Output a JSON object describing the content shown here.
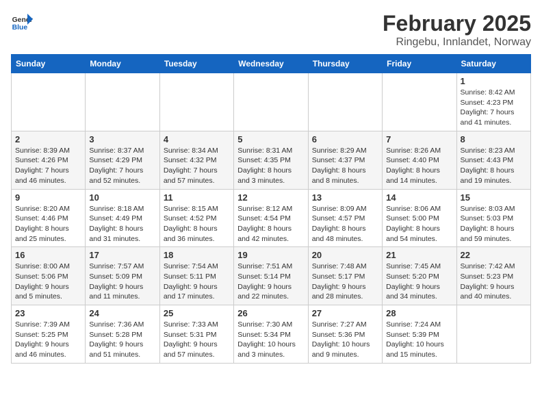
{
  "header": {
    "logo_general": "General",
    "logo_blue": "Blue",
    "month_title": "February 2025",
    "location": "Ringebu, Innlandet, Norway"
  },
  "weekdays": [
    "Sunday",
    "Monday",
    "Tuesday",
    "Wednesday",
    "Thursday",
    "Friday",
    "Saturday"
  ],
  "weeks": [
    [
      {
        "day": "",
        "info": ""
      },
      {
        "day": "",
        "info": ""
      },
      {
        "day": "",
        "info": ""
      },
      {
        "day": "",
        "info": ""
      },
      {
        "day": "",
        "info": ""
      },
      {
        "day": "",
        "info": ""
      },
      {
        "day": "1",
        "info": "Sunrise: 8:42 AM\nSunset: 4:23 PM\nDaylight: 7 hours\nand 41 minutes."
      }
    ],
    [
      {
        "day": "2",
        "info": "Sunrise: 8:39 AM\nSunset: 4:26 PM\nDaylight: 7 hours\nand 46 minutes."
      },
      {
        "day": "3",
        "info": "Sunrise: 8:37 AM\nSunset: 4:29 PM\nDaylight: 7 hours\nand 52 minutes."
      },
      {
        "day": "4",
        "info": "Sunrise: 8:34 AM\nSunset: 4:32 PM\nDaylight: 7 hours\nand 57 minutes."
      },
      {
        "day": "5",
        "info": "Sunrise: 8:31 AM\nSunset: 4:35 PM\nDaylight: 8 hours\nand 3 minutes."
      },
      {
        "day": "6",
        "info": "Sunrise: 8:29 AM\nSunset: 4:37 PM\nDaylight: 8 hours\nand 8 minutes."
      },
      {
        "day": "7",
        "info": "Sunrise: 8:26 AM\nSunset: 4:40 PM\nDaylight: 8 hours\nand 14 minutes."
      },
      {
        "day": "8",
        "info": "Sunrise: 8:23 AM\nSunset: 4:43 PM\nDaylight: 8 hours\nand 19 minutes."
      }
    ],
    [
      {
        "day": "9",
        "info": "Sunrise: 8:20 AM\nSunset: 4:46 PM\nDaylight: 8 hours\nand 25 minutes."
      },
      {
        "day": "10",
        "info": "Sunrise: 8:18 AM\nSunset: 4:49 PM\nDaylight: 8 hours\nand 31 minutes."
      },
      {
        "day": "11",
        "info": "Sunrise: 8:15 AM\nSunset: 4:52 PM\nDaylight: 8 hours\nand 36 minutes."
      },
      {
        "day": "12",
        "info": "Sunrise: 8:12 AM\nSunset: 4:54 PM\nDaylight: 8 hours\nand 42 minutes."
      },
      {
        "day": "13",
        "info": "Sunrise: 8:09 AM\nSunset: 4:57 PM\nDaylight: 8 hours\nand 48 minutes."
      },
      {
        "day": "14",
        "info": "Sunrise: 8:06 AM\nSunset: 5:00 PM\nDaylight: 8 hours\nand 54 minutes."
      },
      {
        "day": "15",
        "info": "Sunrise: 8:03 AM\nSunset: 5:03 PM\nDaylight: 8 hours\nand 59 minutes."
      }
    ],
    [
      {
        "day": "16",
        "info": "Sunrise: 8:00 AM\nSunset: 5:06 PM\nDaylight: 9 hours\nand 5 minutes."
      },
      {
        "day": "17",
        "info": "Sunrise: 7:57 AM\nSunset: 5:09 PM\nDaylight: 9 hours\nand 11 minutes."
      },
      {
        "day": "18",
        "info": "Sunrise: 7:54 AM\nSunset: 5:11 PM\nDaylight: 9 hours\nand 17 minutes."
      },
      {
        "day": "19",
        "info": "Sunrise: 7:51 AM\nSunset: 5:14 PM\nDaylight: 9 hours\nand 22 minutes."
      },
      {
        "day": "20",
        "info": "Sunrise: 7:48 AM\nSunset: 5:17 PM\nDaylight: 9 hours\nand 28 minutes."
      },
      {
        "day": "21",
        "info": "Sunrise: 7:45 AM\nSunset: 5:20 PM\nDaylight: 9 hours\nand 34 minutes."
      },
      {
        "day": "22",
        "info": "Sunrise: 7:42 AM\nSunset: 5:23 PM\nDaylight: 9 hours\nand 40 minutes."
      }
    ],
    [
      {
        "day": "23",
        "info": "Sunrise: 7:39 AM\nSunset: 5:25 PM\nDaylight: 9 hours\nand 46 minutes."
      },
      {
        "day": "24",
        "info": "Sunrise: 7:36 AM\nSunset: 5:28 PM\nDaylight: 9 hours\nand 51 minutes."
      },
      {
        "day": "25",
        "info": "Sunrise: 7:33 AM\nSunset: 5:31 PM\nDaylight: 9 hours\nand 57 minutes."
      },
      {
        "day": "26",
        "info": "Sunrise: 7:30 AM\nSunset: 5:34 PM\nDaylight: 10 hours\nand 3 minutes."
      },
      {
        "day": "27",
        "info": "Sunrise: 7:27 AM\nSunset: 5:36 PM\nDaylight: 10 hours\nand 9 minutes."
      },
      {
        "day": "28",
        "info": "Sunrise: 7:24 AM\nSunset: 5:39 PM\nDaylight: 10 hours\nand 15 minutes."
      },
      {
        "day": "",
        "info": ""
      }
    ]
  ]
}
